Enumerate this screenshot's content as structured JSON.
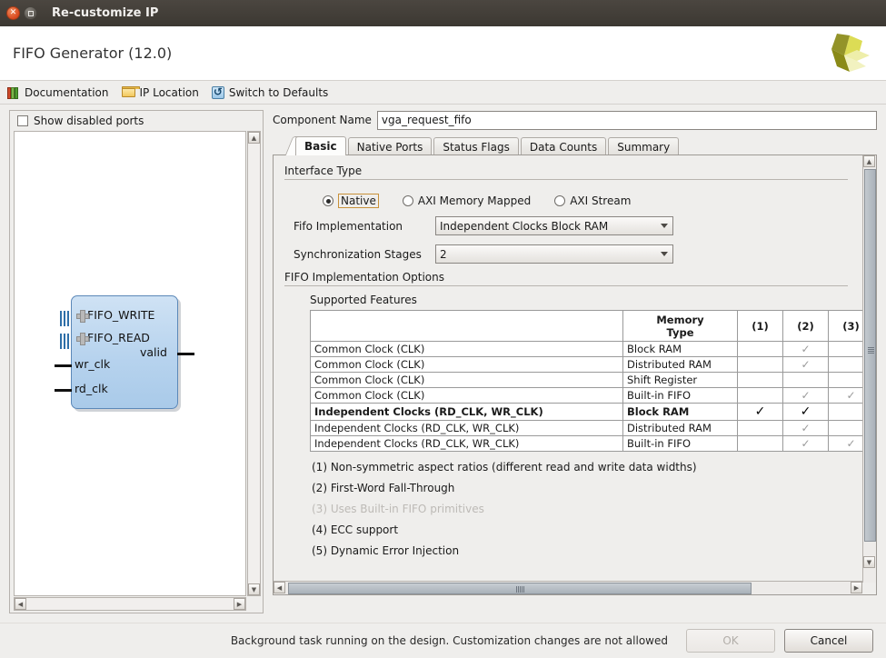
{
  "window": {
    "title": "Re-customize IP",
    "close_icon": "close-icon",
    "maximize_icon": "maximize-icon"
  },
  "header": {
    "title": "FIFO Generator (12.0)",
    "logo_name": "xilinx-logo"
  },
  "toolbar": {
    "items": [
      {
        "label": "Documentation",
        "icon": "books-icon"
      },
      {
        "label": "IP Location",
        "icon": "folder-icon"
      },
      {
        "label": "Switch to Defaults",
        "icon": "refresh-icon"
      }
    ]
  },
  "left_panel": {
    "show_disabled_ports": {
      "label": "Show disabled ports",
      "checked": false
    },
    "symbol": {
      "ports": [
        {
          "name": "FIFO_WRITE",
          "type": "bus",
          "expandable": true
        },
        {
          "name": "FIFO_READ",
          "type": "bus",
          "expandable": true
        },
        {
          "name": "wr_clk",
          "type": "input"
        },
        {
          "name": "rd_clk",
          "type": "input"
        },
        {
          "name": "valid",
          "type": "output"
        }
      ]
    }
  },
  "component": {
    "label": "Component Name",
    "value": "vga_request_fifo"
  },
  "tabs": [
    {
      "label": "Basic",
      "active": true
    },
    {
      "label": "Native Ports",
      "active": false
    },
    {
      "label": "Status Flags",
      "active": false
    },
    {
      "label": "Data Counts",
      "active": false
    },
    {
      "label": "Summary",
      "active": false
    }
  ],
  "basic": {
    "interface_type": {
      "header": "Interface Type",
      "options": [
        {
          "label": "Native",
          "selected": true,
          "focused": true
        },
        {
          "label": "AXI Memory Mapped",
          "selected": false,
          "focused": false
        },
        {
          "label": "AXI Stream",
          "selected": false,
          "focused": false
        }
      ]
    },
    "fifo_implementation": {
      "label": "Fifo Implementation",
      "value": "Independent Clocks Block RAM"
    },
    "synchronization_stages": {
      "label": "Synchronization Stages",
      "value": "2"
    },
    "options_header": "FIFO Implementation Options",
    "supported_features_label": "Supported Features",
    "table": {
      "columns": [
        "",
        "Memory\nType",
        "(1)",
        "(2)",
        "(3)"
      ],
      "column_headers": {
        "clocking": "",
        "memory_type": "Memory Type",
        "c1": "(1)",
        "c2": "(2)",
        "c3": "(3)"
      },
      "rows": [
        {
          "clocking": "Common Clock (CLK)",
          "memory": "Block RAM",
          "c1": "",
          "c2": "✓",
          "c3": "",
          "selected": false
        },
        {
          "clocking": "Common Clock (CLK)",
          "memory": "Distributed RAM",
          "c1": "",
          "c2": "✓",
          "c3": "",
          "selected": false
        },
        {
          "clocking": "Common Clock (CLK)",
          "memory": "Shift Register",
          "c1": "",
          "c2": "",
          "c3": "",
          "selected": false
        },
        {
          "clocking": "Common Clock (CLK)",
          "memory": "Built-in FIFO",
          "c1": "",
          "c2": "✓",
          "c3": "✓",
          "selected": false
        },
        {
          "clocking": "Independent Clocks (RD_CLK, WR_CLK)",
          "memory": "Block RAM",
          "c1": "✓",
          "c2": "✓",
          "c3": "",
          "selected": true
        },
        {
          "clocking": "Independent Clocks (RD_CLK, WR_CLK)",
          "memory": "Distributed RAM",
          "c1": "",
          "c2": "✓",
          "c3": "",
          "selected": false
        },
        {
          "clocking": "Independent Clocks (RD_CLK, WR_CLK)",
          "memory": "Built-in FIFO",
          "c1": "",
          "c2": "✓",
          "c3": "✓",
          "selected": false
        }
      ]
    },
    "notes": [
      {
        "text": "(1) Non-symmetric aspect ratios (different read and write data widths)",
        "dim": false
      },
      {
        "text": "(2) First-Word Fall-Through",
        "dim": false
      },
      {
        "text": "(3) Uses Built-in FIFO primitives",
        "dim": true
      },
      {
        "text": "(4) ECC support",
        "dim": false
      },
      {
        "text": "(5) Dynamic Error Injection",
        "dim": false
      }
    ]
  },
  "footer": {
    "status": "Background task running on the design. Customization changes are not allowed",
    "ok_label": "OK",
    "ok_enabled": false,
    "cancel_label": "Cancel",
    "cancel_enabled": true
  }
}
